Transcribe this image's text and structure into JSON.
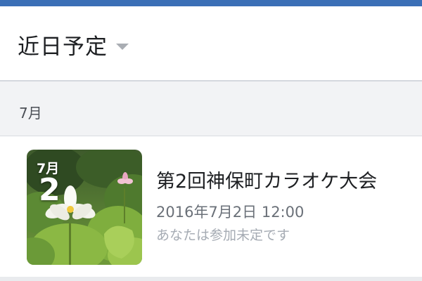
{
  "header": {
    "title": "近日予定"
  },
  "section": {
    "label": "7月"
  },
  "event": {
    "thumb_month": "7月",
    "thumb_day": "2",
    "title": "第2回神保町カラオケ大会",
    "datetime": "2016年7月2日 12:00",
    "status": "あなたは参加未定です"
  },
  "colors": {
    "accent_bar": "#3b6fb6",
    "section_bg": "#f2f3f5"
  },
  "icons": {
    "header_dropdown": "caret-down-icon"
  }
}
